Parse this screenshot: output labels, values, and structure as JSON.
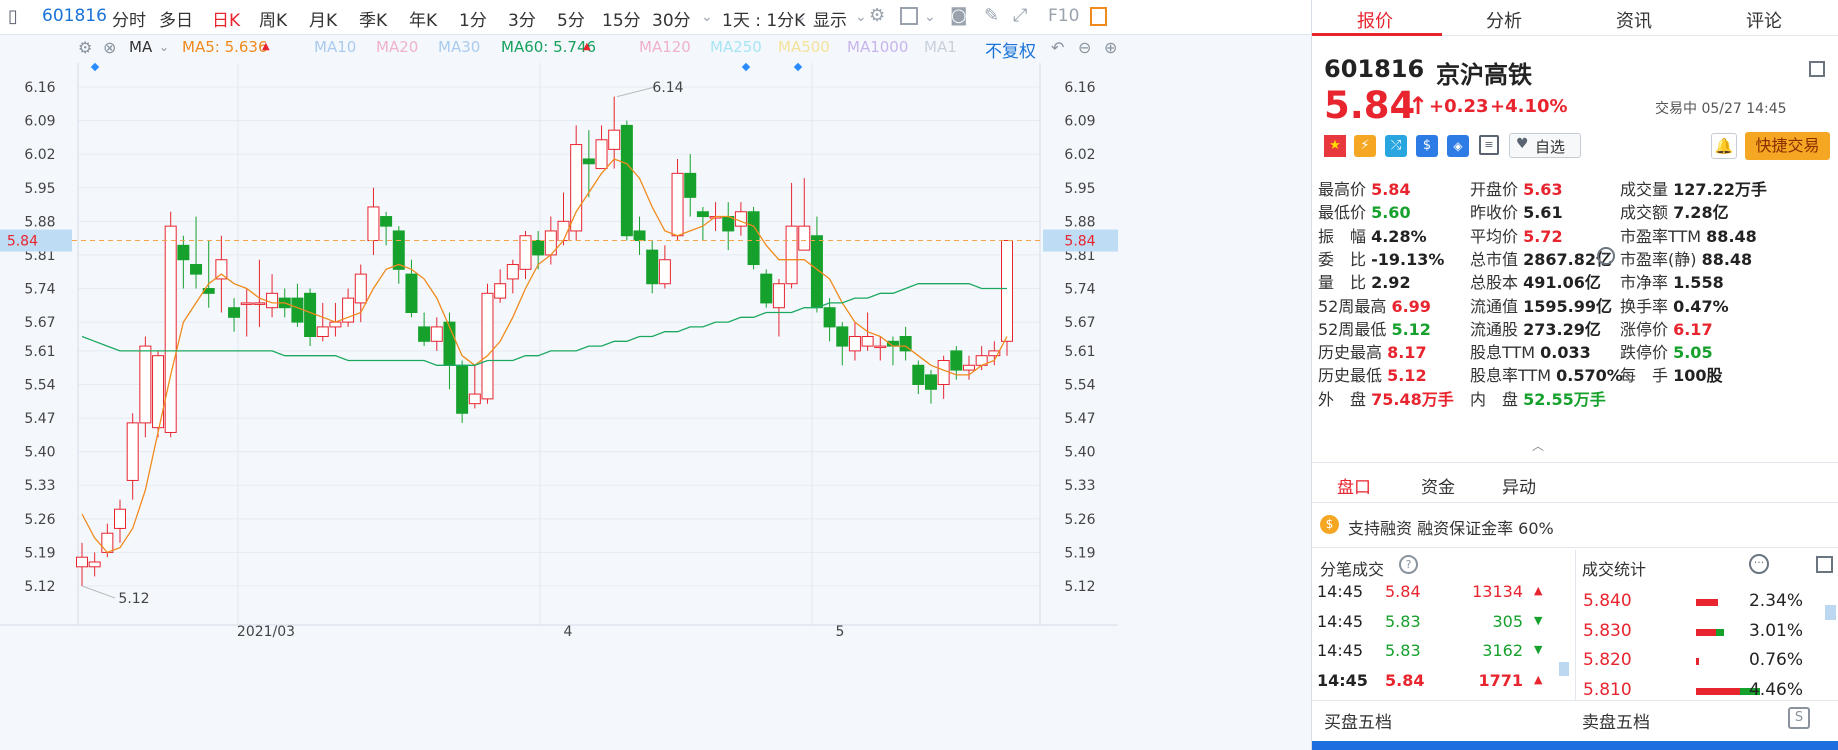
{
  "topbar": {
    "code": "601816",
    "periods": [
      "分时",
      "多日",
      "日K",
      "周K",
      "月K",
      "季K",
      "年K",
      "1分",
      "3分",
      "5分",
      "15分",
      "30分"
    ],
    "active_period": "日K",
    "range": "1天 : 1分K",
    "display": "显示",
    "f10": "F10"
  },
  "indicators": {
    "ma": "MA",
    "ma5": "MA5: 5.636",
    "ma10": "MA10",
    "ma20": "MA20",
    "ma30": "MA30",
    "ma60": "MA60: 5.746",
    "ma120": "MA120",
    "ma250": "MA250",
    "ma500": "MA500",
    "ma1000": "MA1000",
    "ma1": "MA1",
    "adjust": "不复权"
  },
  "chart_data": {
    "type": "candlestick",
    "y_ticks": [
      "6.16",
      "6.09",
      "6.02",
      "5.95",
      "5.88",
      "5.81",
      "5.74",
      "5.67",
      "5.61",
      "5.54",
      "5.47",
      "5.40",
      "5.33",
      "5.26",
      "5.19",
      "5.12"
    ],
    "x_labels": [
      "2021/03",
      "4",
      "5"
    ],
    "current_price": "5.84",
    "high_annotation": "6.14",
    "low_annotation": "5.12",
    "ylim": [
      5.1,
      6.18
    ],
    "candles": [
      [
        5.16,
        5.18,
        5.21,
        5.12
      ],
      [
        5.16,
        5.17,
        5.19,
        5.14
      ],
      [
        5.19,
        5.23,
        5.25,
        5.18
      ],
      [
        5.24,
        5.28,
        5.3,
        5.21
      ],
      [
        5.34,
        5.46,
        5.48,
        5.3
      ],
      [
        5.46,
        5.62,
        5.64,
        5.43
      ],
      [
        5.45,
        5.6,
        5.61,
        5.43
      ],
      [
        5.44,
        5.87,
        5.9,
        5.43
      ],
      [
        5.83,
        5.8,
        5.85,
        5.74
      ],
      [
        5.79,
        5.77,
        5.89,
        5.74
      ],
      [
        5.74,
        5.73,
        5.84,
        5.7
      ],
      [
        5.76,
        5.8,
        5.85,
        5.69
      ],
      [
        5.7,
        5.68,
        5.72,
        5.65
      ],
      [
        5.71,
        5.71,
        5.74,
        5.64
      ],
      [
        5.71,
        5.71,
        5.8,
        5.66
      ],
      [
        5.7,
        5.73,
        5.77,
        5.68
      ],
      [
        5.72,
        5.7,
        5.74,
        5.68
      ],
      [
        5.72,
        5.67,
        5.75,
        5.66
      ],
      [
        5.73,
        5.64,
        5.74,
        5.62
      ],
      [
        5.64,
        5.66,
        5.71,
        5.63
      ],
      [
        5.66,
        5.67,
        5.71,
        5.64
      ],
      [
        5.67,
        5.72,
        5.74,
        5.66
      ],
      [
        5.71,
        5.77,
        5.79,
        5.67
      ],
      [
        5.84,
        5.91,
        5.95,
        5.81
      ],
      [
        5.89,
        5.87,
        5.9,
        5.83
      ],
      [
        5.86,
        5.78,
        5.87,
        5.75
      ],
      [
        5.77,
        5.69,
        5.8,
        5.68
      ],
      [
        5.66,
        5.63,
        5.69,
        5.62
      ],
      [
        5.63,
        5.66,
        5.68,
        5.61
      ],
      [
        5.67,
        5.58,
        5.69,
        5.53
      ],
      [
        5.58,
        5.48,
        5.59,
        5.46
      ],
      [
        5.5,
        5.52,
        5.58,
        5.49
      ],
      [
        5.51,
        5.73,
        5.75,
        5.5
      ],
      [
        5.72,
        5.75,
        5.78,
        5.71
      ],
      [
        5.76,
        5.79,
        5.8,
        5.73
      ],
      [
        5.78,
        5.85,
        5.86,
        5.76
      ],
      [
        5.84,
        5.81,
        5.86,
        5.78
      ],
      [
        5.81,
        5.86,
        5.89,
        5.79
      ],
      [
        5.84,
        5.88,
        5.94,
        5.83
      ],
      [
        5.86,
        6.04,
        6.08,
        5.84
      ],
      [
        6.01,
        6.0,
        6.07,
        5.93
      ],
      [
        5.99,
        6.05,
        6.08,
        5.99
      ],
      [
        6.03,
        6.07,
        6.14,
        5.99
      ],
      [
        6.08,
        5.85,
        6.09,
        5.84
      ],
      [
        5.86,
        5.84,
        5.89,
        5.81
      ],
      [
        5.82,
        5.75,
        5.84,
        5.73
      ],
      [
        5.75,
        5.8,
        5.83,
        5.74
      ],
      [
        5.85,
        5.98,
        6.01,
        5.84
      ],
      [
        5.98,
        5.93,
        6.02,
        5.89
      ],
      [
        5.9,
        5.89,
        5.91,
        5.84
      ],
      [
        5.89,
        5.89,
        5.92,
        5.86
      ],
      [
        5.89,
        5.86,
        5.92,
        5.82
      ],
      [
        5.87,
        5.9,
        5.92,
        5.85
      ],
      [
        5.9,
        5.79,
        5.91,
        5.78
      ],
      [
        5.77,
        5.71,
        5.78,
        5.7
      ],
      [
        5.7,
        5.75,
        5.76,
        5.64
      ],
      [
        5.75,
        5.87,
        5.96,
        5.74
      ],
      [
        5.82,
        5.87,
        5.97,
        5.82
      ],
      [
        5.85,
        5.7,
        5.89,
        5.69
      ],
      [
        5.7,
        5.66,
        5.72,
        5.63
      ],
      [
        5.66,
        5.62,
        5.67,
        5.58
      ],
      [
        5.61,
        5.64,
        5.67,
        5.59
      ],
      [
        5.62,
        5.64,
        5.69,
        5.61
      ],
      [
        5.62,
        5.62,
        5.64,
        5.59
      ],
      [
        5.63,
        5.62,
        5.64,
        5.58
      ],
      [
        5.64,
        5.61,
        5.66,
        5.59
      ],
      [
        5.58,
        5.54,
        5.59,
        5.52
      ],
      [
        5.56,
        5.53,
        5.57,
        5.5
      ],
      [
        5.54,
        5.59,
        5.6,
        5.51
      ],
      [
        5.61,
        5.57,
        5.62,
        5.55
      ],
      [
        5.57,
        5.58,
        5.6,
        5.55
      ],
      [
        5.58,
        5.6,
        5.62,
        5.57
      ],
      [
        5.6,
        5.61,
        5.63,
        5.58
      ],
      [
        5.63,
        5.84,
        5.84,
        5.6
      ]
    ],
    "ma5": [
      5.27,
      5.22,
      5.19,
      5.2,
      5.24,
      5.32,
      5.44,
      5.56,
      5.67,
      5.71,
      5.75,
      5.77,
      5.75,
      5.74,
      5.72,
      5.71,
      5.71,
      5.7,
      5.69,
      5.68,
      5.67,
      5.68,
      5.69,
      5.74,
      5.78,
      5.79,
      5.78,
      5.76,
      5.72,
      5.66,
      5.6,
      5.58,
      5.6,
      5.63,
      5.68,
      5.74,
      5.79,
      5.81,
      5.84,
      5.9,
      5.94,
      5.98,
      6.01,
      6.0,
      5.97,
      5.91,
      5.86,
      5.85,
      5.86,
      5.87,
      5.89,
      5.89,
      5.88,
      5.87,
      5.83,
      5.8,
      5.8,
      5.8,
      5.78,
      5.76,
      5.71,
      5.67,
      5.65,
      5.64,
      5.62,
      5.62,
      5.6,
      5.58,
      5.57,
      5.56,
      5.56,
      5.58,
      5.59,
      5.64
    ],
    "ma60": [
      5.64,
      5.63,
      5.62,
      5.61,
      5.61,
      5.61,
      5.61,
      5.61,
      5.61,
      5.61,
      5.61,
      5.61,
      5.61,
      5.61,
      5.61,
      5.61,
      5.6,
      5.6,
      5.6,
      5.6,
      5.6,
      5.59,
      5.59,
      5.59,
      5.59,
      5.59,
      5.59,
      5.59,
      5.58,
      5.58,
      5.58,
      5.58,
      5.59,
      5.59,
      5.59,
      5.6,
      5.6,
      5.61,
      5.61,
      5.61,
      5.62,
      5.62,
      5.63,
      5.63,
      5.64,
      5.64,
      5.65,
      5.65,
      5.66,
      5.66,
      5.67,
      5.67,
      5.68,
      5.68,
      5.69,
      5.69,
      5.69,
      5.7,
      5.7,
      5.71,
      5.71,
      5.72,
      5.72,
      5.73,
      5.73,
      5.74,
      5.75,
      5.75,
      5.75,
      5.75,
      5.75,
      5.74,
      5.74,
      5.74
    ]
  },
  "quote": {
    "tabs": [
      "报价",
      "分析",
      "资讯",
      "评论"
    ],
    "code": "601816",
    "name": "京沪高铁",
    "price": "5.84",
    "change": "+0.23",
    "change_pct": "+4.10%",
    "status": "交易中 05/27 14:45",
    "watchlist": "自选",
    "quick_trade": "快捷交易",
    "stats": [
      [
        [
          "最高价",
          "5.84",
          "red"
        ],
        [
          "开盘价",
          "5.63",
          "red"
        ],
        [
          "成交量",
          "127.22万手",
          "dark"
        ]
      ],
      [
        [
          "最低价",
          "5.60",
          "grn"
        ],
        [
          "昨收价",
          "5.61",
          "dark"
        ],
        [
          "成交额",
          "7.28亿",
          "dark"
        ]
      ],
      [
        [
          "振　幅",
          "4.28%",
          "dark"
        ],
        [
          "平均价",
          "5.72",
          "red"
        ],
        [
          "市盈率TTM",
          "88.48",
          "dark"
        ]
      ],
      [
        [
          "委　比",
          "-19.13%",
          "dark"
        ],
        [
          "总市值",
          "2867.82亿",
          "dark"
        ],
        [
          "市盈率(静)",
          "88.48",
          "dark"
        ]
      ],
      [
        [
          "量　比",
          "2.92",
          "dark"
        ],
        [
          "总股本",
          "491.06亿",
          "dark"
        ],
        [
          "市净率",
          "1.558",
          "dark"
        ]
      ],
      [
        [
          "52周最高",
          "6.99",
          "red"
        ],
        [
          "流通值",
          "1595.99亿",
          "dark"
        ],
        [
          "换手率",
          "0.47%",
          "dark"
        ]
      ],
      [
        [
          "52周最低",
          "5.12",
          "grn"
        ],
        [
          "流通股",
          "273.29亿",
          "dark"
        ],
        [
          "涨停价",
          "6.17",
          "red"
        ]
      ],
      [
        [
          "历史最高",
          "8.17",
          "red"
        ],
        [
          "股息TTM",
          "0.033",
          "dark"
        ],
        [
          "跌停价",
          "5.05",
          "grn"
        ]
      ],
      [
        [
          "历史最低",
          "5.12",
          "red"
        ],
        [
          "股息率TTM",
          "0.570%",
          "dark"
        ],
        [
          "每　手",
          "100股",
          "dark"
        ]
      ],
      [
        [
          "外　盘",
          "75.48万手",
          "red"
        ],
        [
          "内　盘",
          "52.55万手",
          "grn"
        ],
        [
          "",
          "",
          " "
        ]
      ]
    ],
    "sub_tabs": [
      "盘口",
      "资金",
      "异动"
    ],
    "margin_note": "支持融资 融资保证金率 60%",
    "ticks_title": "分笔成交",
    "ticks": [
      [
        "14:45",
        "5.84",
        "13134",
        "up"
      ],
      [
        "14:45",
        "5.83",
        "305",
        "down"
      ],
      [
        "14:45",
        "5.83",
        "3162",
        "down"
      ],
      [
        "14:45",
        "5.84",
        "1771",
        "up"
      ]
    ],
    "stats_title": "成交统计",
    "dist": [
      [
        "5.840",
        "2.34%"
      ],
      [
        "5.830",
        "3.01%"
      ],
      [
        "5.820",
        "0.76%"
      ],
      [
        "5.810",
        "4.46%"
      ]
    ],
    "buy5": "买盘五档",
    "sell5": "卖盘五档"
  }
}
